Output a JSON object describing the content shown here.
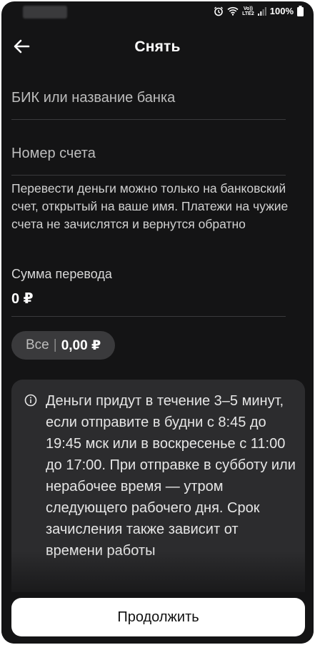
{
  "status_bar": {
    "battery": "100%",
    "network_type": "LTE2",
    "volte": "Vo))",
    "icons": [
      "alarm-icon",
      "wifi-icon",
      "lte-icon",
      "signal-icon",
      "battery-icon"
    ]
  },
  "header": {
    "back_icon": "arrow-left-icon",
    "title": "Снять"
  },
  "form": {
    "bik_placeholder": "БИК или название банка",
    "account_placeholder": "Номер счета",
    "notice": "Перевести деньги можно только на банковский счет, открытый на ваше имя. Платежи на чужие счета не зачислятся и вернутся обратно",
    "amount_label": "Сумма перевода",
    "amount_value": "0 ₽"
  },
  "chip": {
    "all_label": "Все",
    "separator": "|",
    "balance": "0,00 ₽"
  },
  "info": {
    "icon": "info-circle-icon",
    "text": "Деньги придут в течение 3–5 минут, если отправите в будни с 8:45 до 19:45 мск или в воскресенье с 11:00 до 17:00. При отправке в субботу или нерабочее время — утром следующего рабочего дня. Срок зачисления также зависит от времени работы"
  },
  "footer": {
    "continue_label": "Продолжить"
  }
}
